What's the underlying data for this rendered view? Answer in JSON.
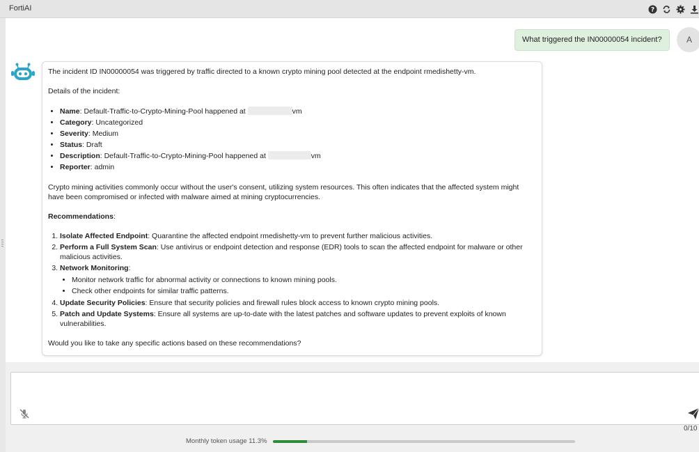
{
  "app": {
    "title": "FortiAI"
  },
  "toolbar": {
    "icons": [
      "help-icon",
      "refresh-icon",
      "settings-icon",
      "download-icon"
    ]
  },
  "user": {
    "avatar_initial": "A",
    "message": "What triggered the IN00000054 incident?"
  },
  "assistant": {
    "intro": "The incident ID IN00000054 was triggered by traffic directed to a known crypto mining pool detected at the endpoint rmedishetty-vm.",
    "details_heading": "Details of the incident:",
    "details": [
      {
        "label": "Name",
        "value": ": Default-Traffic-to-Crypto-Mining-Pool happened at ",
        "suffix": "vm",
        "redacted": true
      },
      {
        "label": "Category",
        "value": ": Uncategorized"
      },
      {
        "label": "Severity",
        "value": ": Medium"
      },
      {
        "label": "Status",
        "value": ": Draft"
      },
      {
        "label": "Description",
        "value": ": Default-Traffic-to-Crypto-Mining-Pool happened at ",
        "suffix": "vm",
        "redacted": true
      },
      {
        "label": "Reporter",
        "value": ": admin"
      }
    ],
    "explanation": "Crypto mining activities commonly occur without the user's consent, utilizing system resources. This often indicates that the affected system might have been compromised or infected with malware aimed at mining cryptocurrencies.",
    "recommendations_heading": "Recommendations",
    "recommendations_colon": ":",
    "recommendations": [
      {
        "label": "Isolate Affected Endpoint",
        "text": ": Quarantine the affected endpoint rmedishetty-vm to prevent further malicious activities."
      },
      {
        "label": "Perform a Full System Scan",
        "text": ": Use antivirus or endpoint detection and response (EDR) tools to scan the affected endpoint for malware or other malicious activities."
      },
      {
        "label": "Network Monitoring",
        "text": ":",
        "sub": [
          "Monitor network traffic for abnormal activity or connections to known mining pools.",
          "Check other endpoints for similar traffic patterns."
        ]
      },
      {
        "label": "Update Security Policies",
        "text": ": Ensure that security policies and firewall rules block access to known crypto mining pools."
      },
      {
        "label": "Patch and Update Systems",
        "text": ": Ensure all systems are up-to-date with the latest patches and software updates to prevent exploits of known vulnerabilities."
      }
    ],
    "closing": "Would you like to take any specific actions based on these recommendations?"
  },
  "composer": {
    "value": "",
    "char_count": "0/10"
  },
  "usage": {
    "label": "Monthly token usage 11.3%",
    "percent": 11.3,
    "color": "#2e8b3a"
  },
  "colors": {
    "bot_icon": "#2aa6c8",
    "user_bubble": "#dff0df"
  }
}
